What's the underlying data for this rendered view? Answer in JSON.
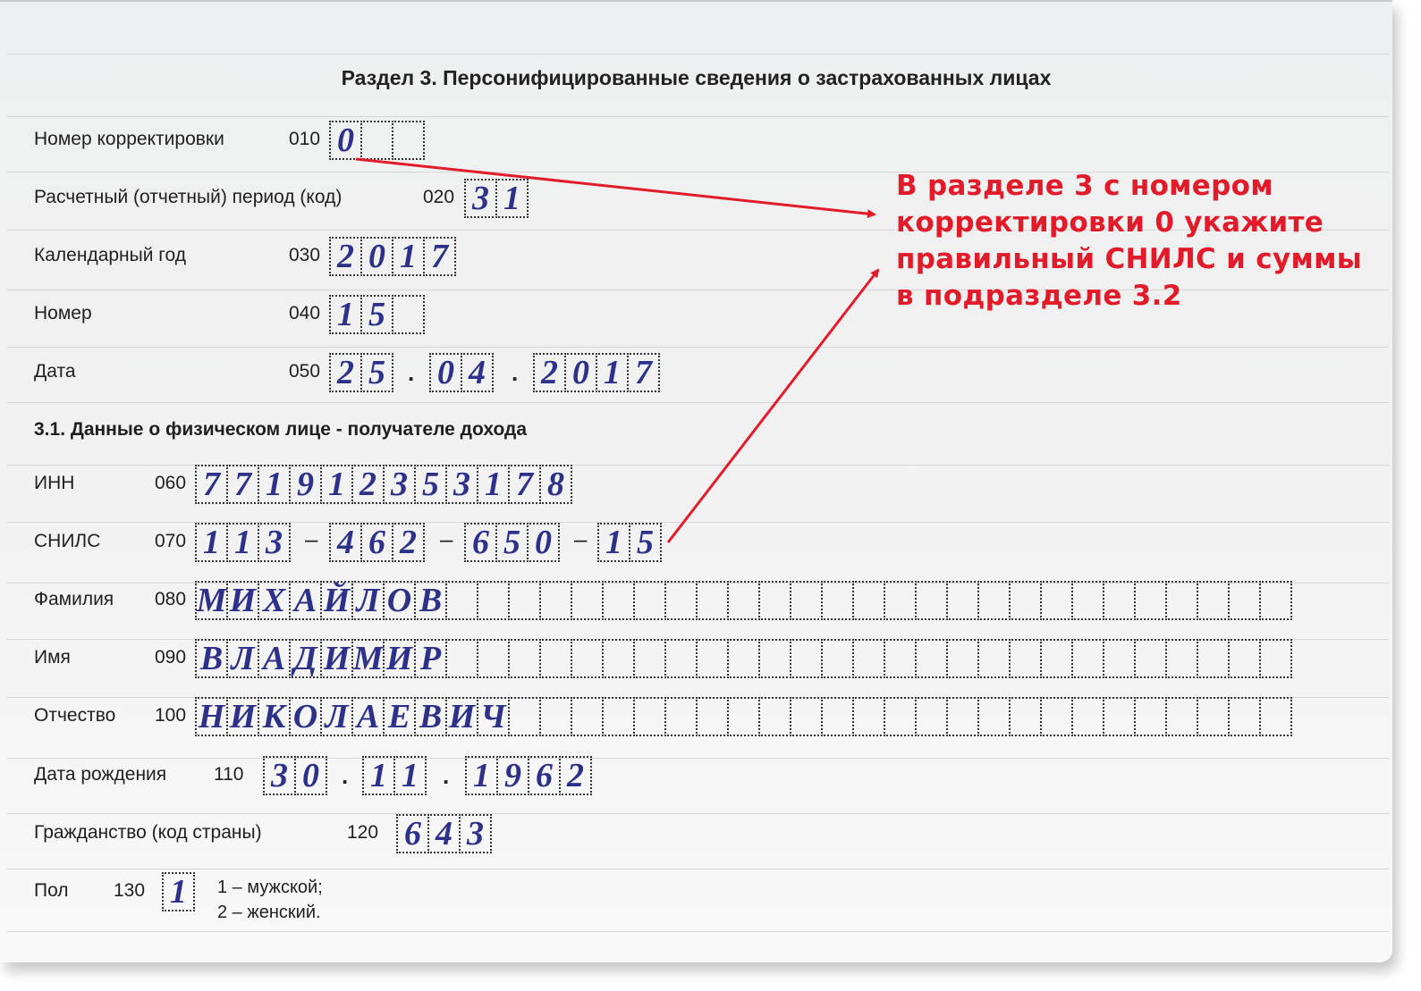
{
  "form": {
    "title": "Раздел 3. Персонифицированные сведения о застрахованных лицах",
    "fields_top": [
      {
        "label": "Номер корректировки",
        "code": "010",
        "cells": [
          "0",
          "",
          ""
        ]
      },
      {
        "label": "Расчетный (отчетный) период (код)",
        "code": "020",
        "cells": [
          "3",
          "1"
        ]
      },
      {
        "label": "Календарный год",
        "code": "030",
        "cells": [
          "2",
          "0",
          "1",
          "7"
        ]
      },
      {
        "label": "Номер",
        "code": "040",
        "cells": [
          "1",
          "5",
          ""
        ]
      },
      {
        "label": "Дата",
        "code": "050",
        "day": [
          "2",
          "5"
        ],
        "month": [
          "0",
          "4"
        ],
        "year": [
          "2",
          "0",
          "1",
          "7"
        ],
        "separator": "."
      }
    ],
    "subsection_title": "3.1. Данные о физическом лице - получателе дохода",
    "inn": {
      "label": "ИНН",
      "code": "060",
      "cells": [
        "7",
        "7",
        "1",
        "9",
        "1",
        "2",
        "3",
        "5",
        "3",
        "1",
        "7",
        "8"
      ]
    },
    "snils": {
      "label": "СНИЛС",
      "code": "070",
      "groups": [
        [
          "1",
          "1",
          "3"
        ],
        [
          "4",
          "6",
          "2"
        ],
        [
          "6",
          "5",
          "0"
        ],
        [
          "1",
          "5"
        ]
      ],
      "separator": "–"
    },
    "surname": {
      "label": "Фамилия",
      "code": "080",
      "value": "МИХАЙЛОВ",
      "total_cells": 35
    },
    "name": {
      "label": "Имя",
      "code": "090",
      "value": "ВЛАДИМИР",
      "total_cells": 35
    },
    "patronymic": {
      "label": "Отчество",
      "code": "100",
      "value": "НИКОЛАЕВИЧ",
      "total_cells": 35
    },
    "birth_date": {
      "label": "Дата рождения",
      "code": "110",
      "day": [
        "3",
        "0"
      ],
      "month": [
        "1",
        "1"
      ],
      "year": [
        "1",
        "9",
        "6",
        "2"
      ],
      "separator": "."
    },
    "citizenship": {
      "label": "Гражданство (код страны)",
      "code": "120",
      "cells": [
        "6",
        "4",
        "3"
      ]
    },
    "sex": {
      "label": "Пол",
      "code": "130",
      "cells": [
        "1"
      ],
      "legend": [
        "1 – мужской;",
        "2 – женский."
      ]
    }
  },
  "annotation": {
    "lines": [
      "В разделе 3 с номером",
      "корректировки 0 укажите",
      "правильный СНИЛС и суммы",
      "в подразделе 3.2"
    ],
    "color": "#e21b2a"
  },
  "colors": {
    "handwriting": "#2e318a",
    "text": "#1f1f1f"
  }
}
